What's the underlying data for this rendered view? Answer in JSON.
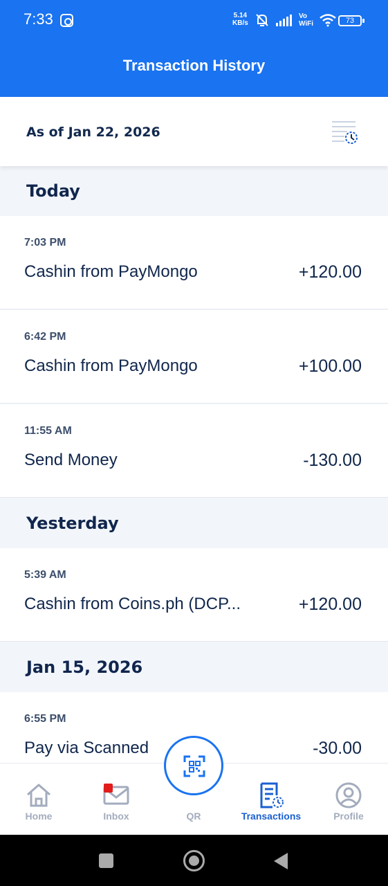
{
  "status_bar": {
    "time": "7:33",
    "speed": "5.14",
    "speed_unit": "KB/s",
    "volte": "Vo",
    "volte_sub": "WiFi",
    "battery": "73"
  },
  "header": {
    "title": "Transaction History"
  },
  "asof": {
    "label": "As of Jan 22, 2026"
  },
  "groups": [
    {
      "title": "Today",
      "items": [
        {
          "time": "7:03 PM",
          "desc": "Cashin from PayMongo",
          "amount": "+120.00"
        },
        {
          "time": "6:42 PM",
          "desc": "Cashin from PayMongo",
          "amount": "+100.00"
        },
        {
          "time": "11:55 AM",
          "desc": "Send Money",
          "amount": "-130.00"
        }
      ]
    },
    {
      "title": "Yesterday",
      "items": [
        {
          "time": "5:39 AM",
          "desc": "Cashin from Coins.ph (DCP...",
          "amount": "+120.00"
        }
      ]
    },
    {
      "title": "Jan 15, 2026",
      "items": [
        {
          "time": "6:55 PM",
          "desc": "Pay via Scanned",
          "amount": "-30.00"
        }
      ]
    }
  ],
  "nav": [
    {
      "label": "Home",
      "icon": "home-icon"
    },
    {
      "label": "Inbox",
      "icon": "mail-icon"
    },
    {
      "label": "QR",
      "icon": "qr-scan-icon"
    },
    {
      "label": "Transactions",
      "icon": "transactions-icon"
    },
    {
      "label": "Profile",
      "icon": "profile-icon"
    }
  ],
  "colors": {
    "brand": "#1a73f0",
    "active": "#1a5fd0",
    "inactive": "#a3acbd",
    "badge": "#e21b1b"
  }
}
